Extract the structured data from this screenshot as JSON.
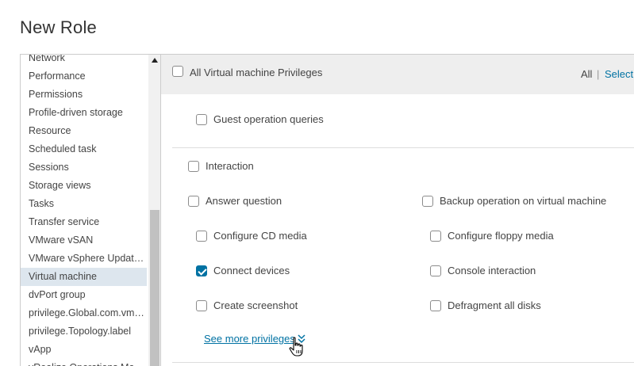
{
  "dialog": {
    "title": "New Role"
  },
  "categories": {
    "items": [
      {
        "label": "Network",
        "selected": false
      },
      {
        "label": "Performance",
        "selected": false
      },
      {
        "label": "Permissions",
        "selected": false
      },
      {
        "label": "Profile-driven storage",
        "selected": false
      },
      {
        "label": "Resource",
        "selected": false
      },
      {
        "label": "Scheduled task",
        "selected": false
      },
      {
        "label": "Sessions",
        "selected": false
      },
      {
        "label": "Storage views",
        "selected": false
      },
      {
        "label": "Tasks",
        "selected": false
      },
      {
        "label": "Transfer service",
        "selected": false
      },
      {
        "label": "VMware vSAN",
        "selected": false
      },
      {
        "label": "VMware vSphere Update Manager",
        "selected": false
      },
      {
        "label": "Virtual machine",
        "selected": true
      },
      {
        "label": "dvPort group",
        "selected": false
      },
      {
        "label": "privilege.Global.com.vmware",
        "selected": false
      },
      {
        "label": "privilege.Topology.label",
        "selected": false
      },
      {
        "label": "vApp",
        "selected": false
      },
      {
        "label": "vRealize Operations Manager",
        "selected": false
      }
    ]
  },
  "privileges": {
    "header": {
      "all_privileges_label": "All Virtual machine Privileges",
      "all_checked": false,
      "all_link": "All",
      "separator": "|",
      "select_link": "Select"
    },
    "guest_operation_queries": {
      "label": "Guest operation queries",
      "checked": false
    },
    "interaction": {
      "label": "Interaction",
      "checked": false
    },
    "items": {
      "answer_question": {
        "label": "Answer question",
        "checked": false
      },
      "backup_operation": {
        "label": "Backup operation on virtual machine",
        "checked": false
      },
      "configure_cd_media": {
        "label": "Configure CD media",
        "checked": false
      },
      "configure_floppy_media": {
        "label": "Configure floppy media",
        "checked": false
      },
      "connect_devices": {
        "label": "Connect devices",
        "checked": true
      },
      "console_interaction": {
        "label": "Console interaction",
        "checked": false
      },
      "create_screenshot": {
        "label": "Create screenshot",
        "checked": false
      },
      "defragment_all_disks": {
        "label": "Defragment all disks",
        "checked": false
      }
    },
    "see_more": "See more privileges"
  },
  "colors": {
    "accent": "#0072a3",
    "selected_bg": "#dde6ee",
    "header_bg": "#eeeeee"
  }
}
